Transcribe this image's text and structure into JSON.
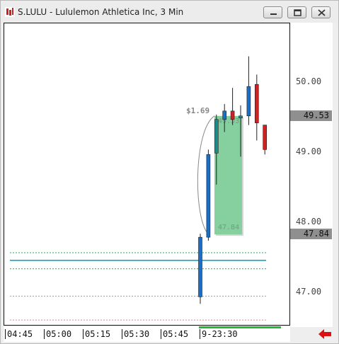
{
  "window": {
    "title": "S.LULU - Lululemon Athletica Inc, 3 Min",
    "controls": [
      "minimize-icon",
      "restore-icon",
      "close-icon"
    ]
  },
  "colors": {
    "up_candle": "#1a6fc4",
    "up_candle_teal": "#1f8a8a",
    "down_candle": "#cc2222",
    "range_box": "#86cf9e",
    "green_line": "#22aa55",
    "blue_line": "#11a3cc",
    "gray_line": "#a0a0a0",
    "pink_line": "#d88aa0"
  },
  "price_axis": {
    "ticks": [
      "50.00",
      "49.00",
      "48.00",
      "47.00"
    ],
    "current_price_label": "49.53",
    "low_price_label": "47.84"
  },
  "annotations": {
    "move_label": "$1.69",
    "box_top_label": "49.53",
    "box_bottom_label": "47.84"
  },
  "time_axis": {
    "ticks": [
      "04:45",
      "05:00",
      "05:15",
      "05:30",
      "05:45",
      "9-23:30"
    ]
  },
  "chart_data": {
    "type": "candlestick",
    "ylim": [
      46.55,
      50.85
    ],
    "candles": [
      {
        "open": 46.95,
        "high": 47.85,
        "low": 46.85,
        "close": 47.8,
        "dir": "up"
      },
      {
        "open": 47.8,
        "high": 49.05,
        "low": 47.75,
        "close": 48.98,
        "dir": "up"
      },
      {
        "open": 49.0,
        "high": 49.55,
        "low": 48.55,
        "close": 49.48,
        "dir": "up"
      },
      {
        "open": 49.48,
        "high": 49.7,
        "low": 49.3,
        "close": 49.6,
        "dir": "up"
      },
      {
        "open": 49.6,
        "high": 49.93,
        "low": 49.4,
        "close": 49.48,
        "dir": "down"
      },
      {
        "open": 49.5,
        "high": 49.68,
        "low": 48.95,
        "close": 49.53,
        "dir": "up"
      },
      {
        "open": 49.53,
        "high": 50.38,
        "low": 49.4,
        "close": 49.95,
        "dir": "up"
      },
      {
        "open": 49.98,
        "high": 50.12,
        "low": 49.18,
        "close": 49.43,
        "dir": "down"
      },
      {
        "open": 49.4,
        "high": 49.4,
        "low": 48.98,
        "close": 49.05,
        "dir": "down"
      }
    ],
    "levels": [
      {
        "price": 47.58,
        "style": "green-dotted"
      },
      {
        "price": 47.47,
        "style": "blue-solid"
      },
      {
        "price": 47.35,
        "style": "green-dotted"
      },
      {
        "price": 46.96,
        "style": "gray-dotted"
      },
      {
        "price": 46.62,
        "style": "pink-dotted"
      }
    ],
    "range_box": {
      "top": 49.53,
      "bottom": 47.84
    }
  }
}
